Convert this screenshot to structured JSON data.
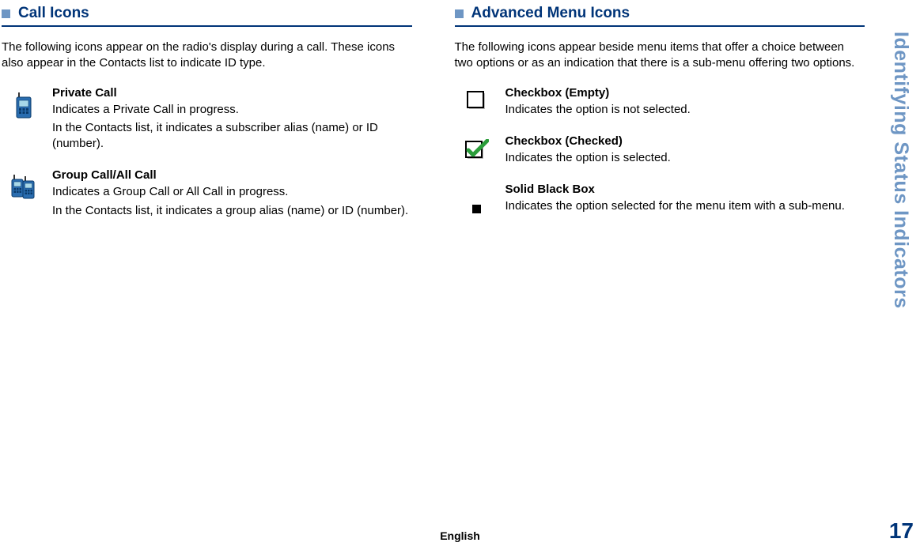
{
  "sideTab": "Identifying Status Indicators",
  "pageNumber": "17",
  "language": "English",
  "left": {
    "title": "Call Icons",
    "intro": "The following icons appear on the radio's display during a call. These icons also appear in the Contacts list to indicate ID type.",
    "entries": [
      {
        "title": "Private Call",
        "desc1": "Indicates a Private Call in progress.",
        "desc2": "In the Contacts list, it indicates a subscriber alias (name) or ID (number)."
      },
      {
        "title": "Group Call/All Call",
        "desc1": "Indicates a Group Call or All Call in progress.",
        "desc2": "In the Contacts list, it indicates a group alias (name) or ID (number)."
      }
    ]
  },
  "right": {
    "title": "Advanced Menu Icons",
    "intro": "The following icons appear beside menu items that offer a choice between two options or as an indication that there is a sub-menu offering two options.",
    "entries": [
      {
        "title": "Checkbox (Empty)",
        "desc1": "Indicates the option is not selected."
      },
      {
        "title": "Checkbox (Checked)",
        "desc1": "Indicates the option is selected."
      },
      {
        "title": "Solid Black Box",
        "desc1": "Indicates the option selected for the menu item with a sub-menu."
      }
    ]
  }
}
